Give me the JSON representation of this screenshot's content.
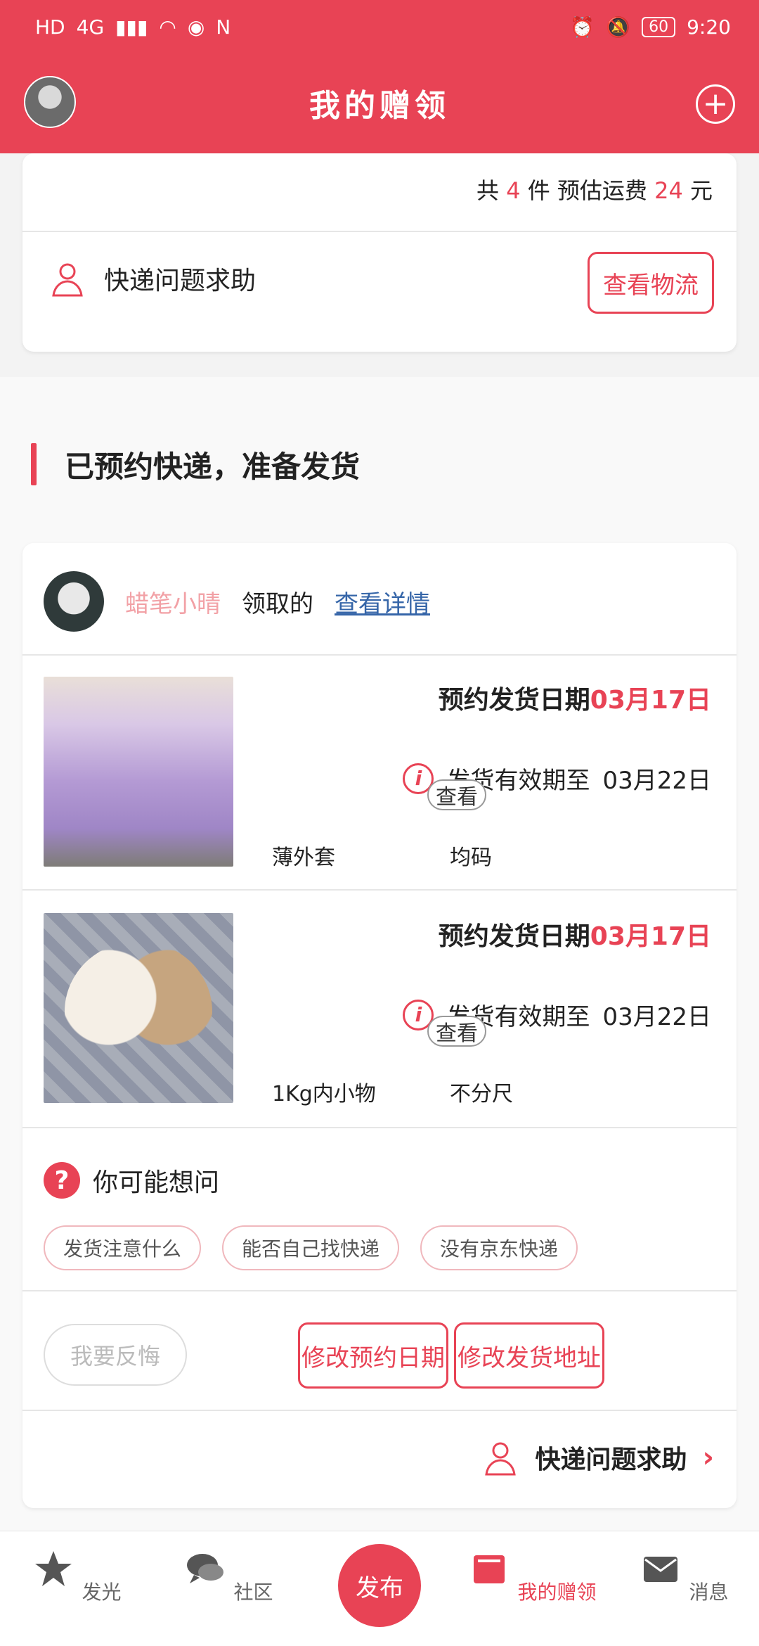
{
  "status_bar": {
    "network": "4G",
    "battery": "60",
    "time": "9:20"
  },
  "header": {
    "title": "我的赠领"
  },
  "top_card": {
    "summary_prefix": "共",
    "count": "4",
    "summary_middle": "件 预估运费",
    "fee": "24",
    "summary_suffix": "元",
    "help_label": "快递问题求助",
    "view_logistics": "查看物流"
  },
  "section": {
    "title": "已预约快递，准备发货"
  },
  "order": {
    "nickname": "蜡笔小晴",
    "claimed": "领取的",
    "view_details": "查看详情",
    "items": [
      {
        "date_label": "预约发货日期",
        "date_value": "03月17日",
        "valid_label": "发货有效期至",
        "valid_value": "03月22日",
        "name": "薄外套",
        "size": "均码",
        "view": "查看"
      },
      {
        "date_label": "预约发货日期",
        "date_value": "03月17日",
        "valid_label": "发货有效期至",
        "valid_value": "03月22日",
        "name": "1Kg内小物",
        "size": "不分尺",
        "view": "查看"
      }
    ],
    "ask_title": "你可能想问",
    "chips": [
      "发货注意什么",
      "能否自己找快递",
      "没有京东快递"
    ],
    "feedback": "我要反悔",
    "change_date": "修改预约日期",
    "change_address": "修改发货地址",
    "help_label": "快递问题求助"
  },
  "bottom_nav": {
    "items": [
      {
        "label": "发光",
        "icon": "star-icon"
      },
      {
        "label": "社区",
        "icon": "chat-icon"
      },
      {
        "label": "发布",
        "icon": "publish-icon"
      },
      {
        "label": "我的赠领",
        "icon": "book-icon"
      },
      {
        "label": "消息",
        "icon": "mail-icon"
      }
    ]
  },
  "colors": {
    "accent": "#e84355",
    "link": "#3565a8",
    "nickname": "#f2a1a6"
  }
}
